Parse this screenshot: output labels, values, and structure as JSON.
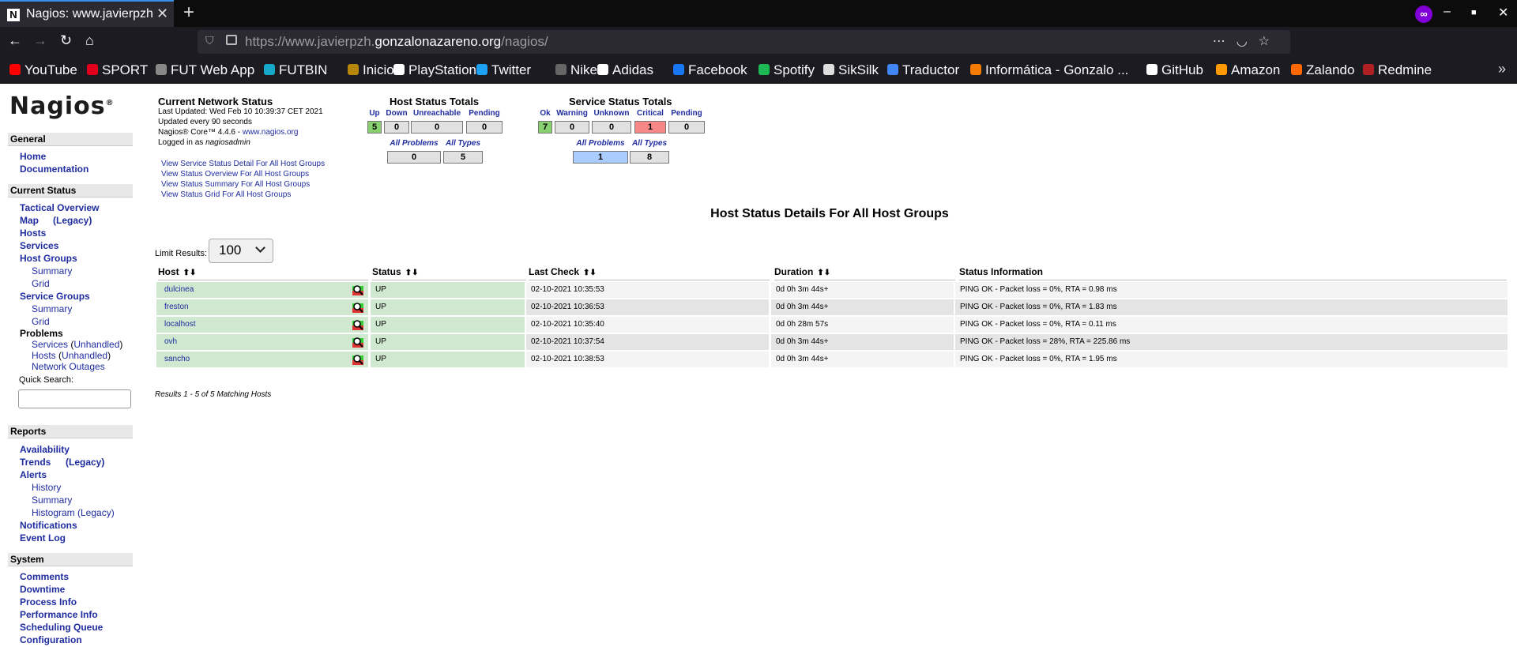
{
  "browser": {
    "tab_title": "Nagios: www.javierpzh.gonzalonazareno.org",
    "favicon_letter": "N",
    "url_prefix": "https://www.javierpzh.",
    "url_domain": "gonzalonazareno.org",
    "url_path": "/nagios/",
    "bookmarks": [
      {
        "label": "YouTube",
        "color": "#ff0000"
      },
      {
        "label": "SPORT",
        "color": "#e2001a"
      },
      {
        "label": "FUT Web App",
        "color": "#888888"
      },
      {
        "label": "FUTBIN",
        "color": "#16a8c8"
      },
      {
        "label": "Inicio",
        "color": "#b8860b"
      },
      {
        "label": "PlayStation",
        "color": "#ffffff"
      },
      {
        "label": "Twitter",
        "color": "#1da1f2"
      },
      {
        "label": "Nike",
        "color": "#666666"
      },
      {
        "label": "Adidas",
        "color": "#ffffff"
      },
      {
        "label": "Facebook",
        "color": "#1877f2"
      },
      {
        "label": "Spotify",
        "color": "#1db954"
      },
      {
        "label": "SikSilk",
        "color": "#dddddd"
      },
      {
        "label": "Traductor",
        "color": "#4285f4"
      },
      {
        "label": "Informática - Gonzalo ...",
        "color": "#f57c00"
      },
      {
        "label": "GitHub",
        "color": "#ffffff"
      },
      {
        "label": "Amazon",
        "color": "#ff9900"
      },
      {
        "label": "Zalando",
        "color": "#ff6900"
      },
      {
        "label": "Redmine",
        "color": "#b32024"
      }
    ]
  },
  "sidebar": {
    "logo": "Nagios",
    "sections": {
      "general": "General",
      "current_status": "Current Status",
      "reports": "Reports",
      "system": "System"
    },
    "general": {
      "home": "Home",
      "documentation": "Documentation"
    },
    "current": {
      "tactical": "Tactical Overview",
      "map": "Map",
      "legacy": "(Legacy)",
      "hosts": "Hosts",
      "services": "Services",
      "host_groups": "Host Groups",
      "hg_summary": "Summary",
      "hg_grid": "Grid",
      "service_groups": "Service Groups",
      "sg_summary": "Summary",
      "sg_grid": "Grid",
      "problems": "Problems",
      "services_p": "Services",
      "unhandled": "Unhandled",
      "hosts_p": "Hosts",
      "unhandled2": "Unhandled",
      "network_outages": "Network Outages",
      "quick_search": "Quick Search:"
    },
    "reports": {
      "availability": "Availability",
      "trends": "Trends",
      "legacy": "(Legacy)",
      "alerts": "Alerts",
      "history": "History",
      "summary": "Summary",
      "histogram": "Histogram (Legacy)",
      "notifications": "Notifications",
      "event_log": "Event Log"
    },
    "system": {
      "comments": "Comments",
      "downtime": "Downtime",
      "process_info": "Process Info",
      "performance_info": "Performance Info",
      "scheduling_queue": "Scheduling Queue",
      "configuration": "Configuration"
    }
  },
  "network_status": {
    "title": "Current Network Status",
    "last_updated": "Last Updated: Wed Feb 10 10:39:37 CET 2021",
    "update_interval": "Updated every 90 seconds",
    "version": "Nagios® Core™ 4.4.6 - ",
    "version_link": "www.nagios.org",
    "logged_in_as": "Logged in as ",
    "user": "nagiosadmin",
    "links": [
      "View Service Status Detail For All Host Groups",
      "View Status Overview For All Host Groups",
      "View Status Summary For All Host Groups",
      "View Status Grid For All Host Groups"
    ]
  },
  "host_totals": {
    "title": "Host Status Totals",
    "headers": [
      "Up",
      "Down",
      "Unreachable",
      "Pending"
    ],
    "values": [
      "5",
      "0",
      "0",
      "0"
    ],
    "colors": [
      "#89d071",
      "#e1e1e1",
      "#e1e1e1",
      "#e1e1e1"
    ],
    "sub_headers": [
      "All Problems",
      "All Types"
    ],
    "sub_values": [
      "0",
      "5"
    ]
  },
  "service_totals": {
    "title": "Service Status Totals",
    "headers": [
      "Ok",
      "Warning",
      "Unknown",
      "Critical",
      "Pending"
    ],
    "values": [
      "7",
      "0",
      "0",
      "1",
      "0"
    ],
    "colors": [
      "#89d071",
      "#e1e1e1",
      "#e1e1e1",
      "#f88888",
      "#e1e1e1"
    ],
    "sub_headers": [
      "All Problems",
      "All Types"
    ],
    "sub_values": [
      "1",
      "8"
    ],
    "sub_colors": [
      "#aaccff",
      "#e1e1e1"
    ]
  },
  "details": {
    "title": "Host Status Details For All Host Groups",
    "limit_label": "Limit Results:",
    "limit_value": "100",
    "columns": [
      "Host",
      "Status",
      "Last Check",
      "Duration",
      "Status Information"
    ],
    "rows": [
      {
        "host": "dulcinea",
        "status": "UP",
        "last_check": "02-10-2021 10:35:53",
        "duration": "0d 0h 3m 44s+",
        "info": "PING OK - Packet loss = 0%, RTA = 0.98 ms"
      },
      {
        "host": "freston",
        "status": "UP",
        "last_check": "02-10-2021 10:36:53",
        "duration": "0d 0h 3m 44s+",
        "info": "PING OK - Packet loss = 0%, RTA = 1.83 ms"
      },
      {
        "host": "localhost",
        "status": "UP",
        "last_check": "02-10-2021 10:35:40",
        "duration": "0d 0h 28m 57s",
        "info": "PING OK - Packet loss = 0%, RTA = 0.11 ms"
      },
      {
        "host": "ovh",
        "status": "UP",
        "last_check": "02-10-2021 10:37:54",
        "duration": "0d 0h 3m 44s+",
        "info": "PING OK - Packet loss = 28%, RTA = 225.86 ms"
      },
      {
        "host": "sancho",
        "status": "UP",
        "last_check": "02-10-2021 10:38:53",
        "duration": "0d 0h 3m 44s+",
        "info": "PING OK - Packet loss = 0%, RTA = 1.95 ms"
      }
    ],
    "results": "Results 1 - 5 of 5 Matching Hosts"
  }
}
